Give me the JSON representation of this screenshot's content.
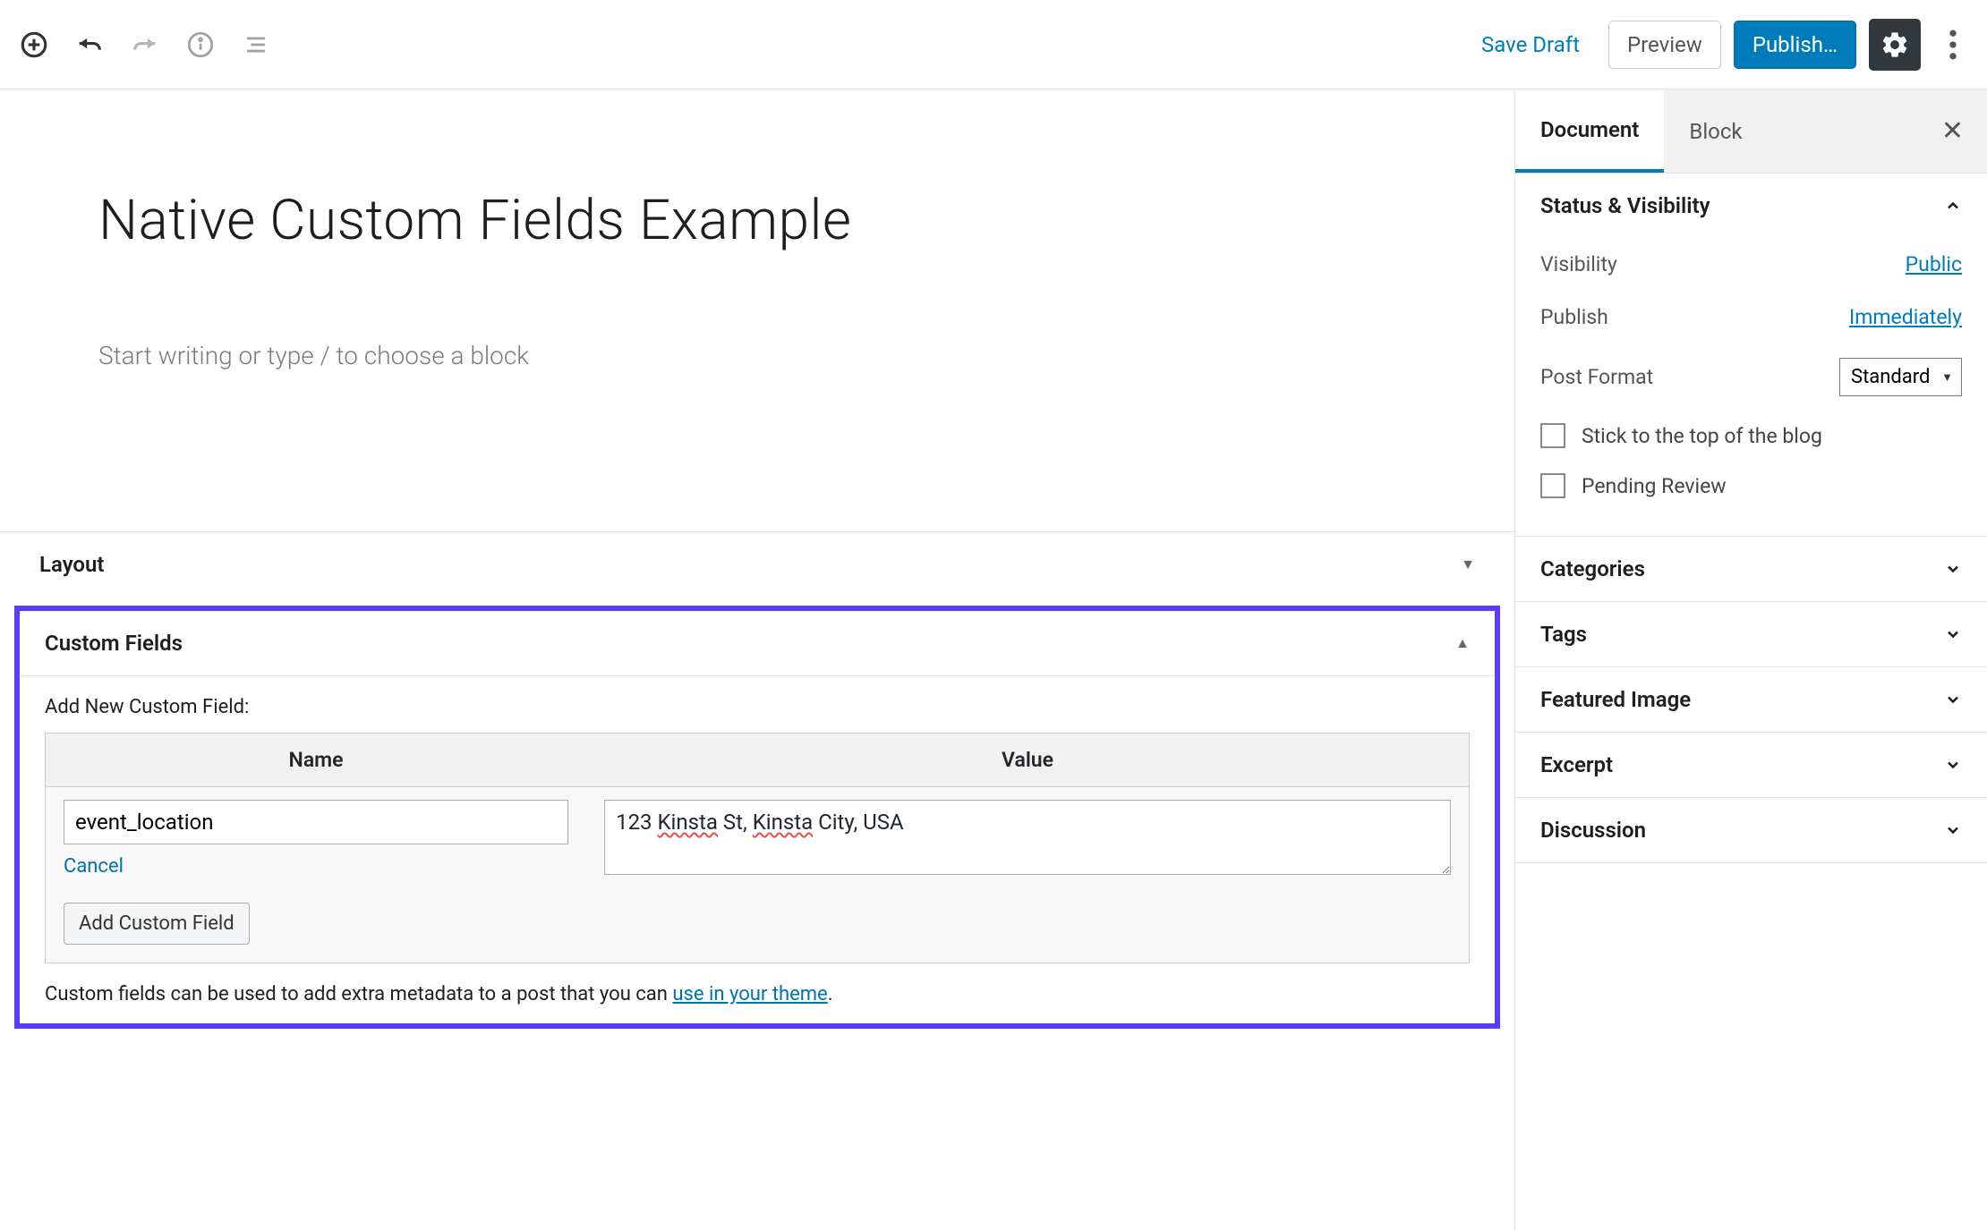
{
  "toolbar": {
    "save_draft": "Save Draft",
    "preview": "Preview",
    "publish": "Publish…"
  },
  "editor": {
    "title": "Native Custom Fields Example",
    "placeholder": "Start writing or type / to choose a block"
  },
  "metaboxes": {
    "layout": {
      "title": "Layout"
    },
    "custom_fields": {
      "title": "Custom Fields",
      "add_new_label": "Add New Custom Field:",
      "name_header": "Name",
      "value_header": "Value",
      "name_value": "event_location",
      "value_value": "123 Kinsta St, Kinsta City, USA",
      "cancel": "Cancel",
      "add_button": "Add Custom Field",
      "help_text": "Custom fields can be used to add extra metadata to a post that you can ",
      "help_link": "use in your theme",
      "help_suffix": "."
    }
  },
  "sidebar": {
    "tabs": {
      "document": "Document",
      "block": "Block"
    },
    "status": {
      "title": "Status & Visibility",
      "visibility_label": "Visibility",
      "visibility_value": "Public",
      "publish_label": "Publish",
      "publish_value": "Immediately",
      "format_label": "Post Format",
      "format_value": "Standard",
      "sticky_label": "Stick to the top of the blog",
      "pending_label": "Pending Review"
    },
    "panels": {
      "categories": "Categories",
      "tags": "Tags",
      "featured_image": "Featured Image",
      "excerpt": "Excerpt",
      "discussion": "Discussion"
    }
  }
}
